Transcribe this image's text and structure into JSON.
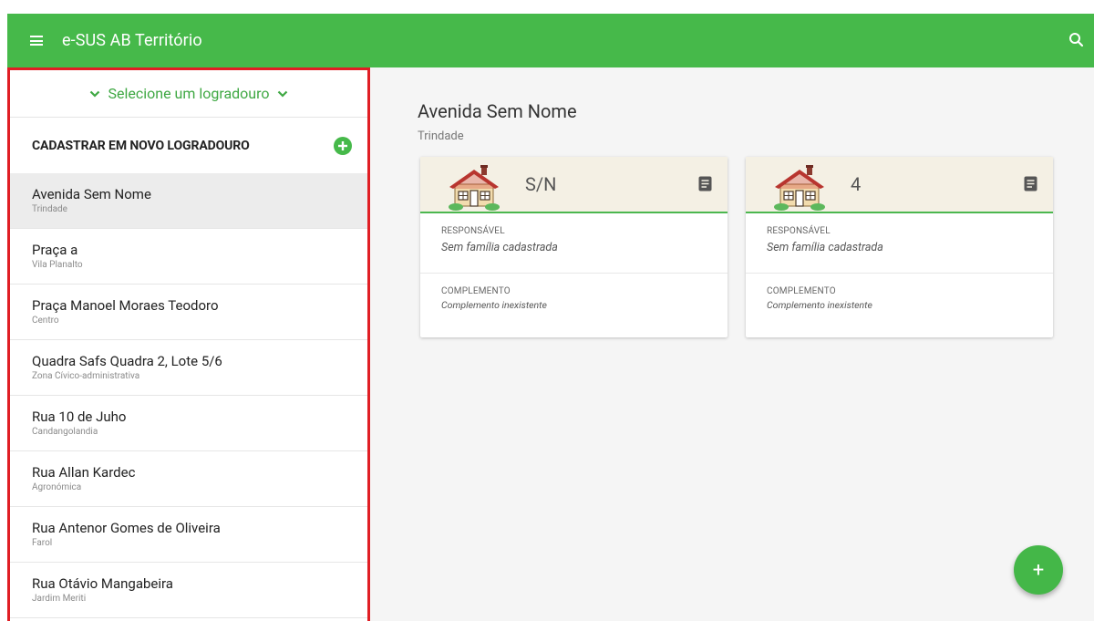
{
  "app": {
    "title": "e-SUS AB Território"
  },
  "icons": {
    "menu": "menu-icon",
    "search": "search-icon",
    "add": "add-circle-icon",
    "note": "note-icon",
    "house": "house-icon",
    "fab": "plus-icon"
  },
  "colors": {
    "primary": "#46b94a",
    "highlight_border": "#e01e24",
    "selected_row": "#ececec",
    "card_header": "#f4f0e4"
  },
  "sidebar": {
    "selector_label": "Selecione um logradouro",
    "new_label": "CADASTRAR EM NOVO LOGRADOURO",
    "items": [
      {
        "name": "Avenida Sem Nome",
        "district": "Trindade",
        "selected": true
      },
      {
        "name": "Praça a",
        "district": "Vila Planalto"
      },
      {
        "name": "Praça Manoel Moraes Teodoro",
        "district": "Centro"
      },
      {
        "name": "Quadra Safs Quadra 2, Lote 5/6",
        "district": "Zona Cívico-administrativa"
      },
      {
        "name": "Rua 10 de Juho",
        "district": "Candangolandia"
      },
      {
        "name": "Rua Allan Kardec",
        "district": "Agronómica"
      },
      {
        "name": "Rua Antenor Gomes de Oliveira",
        "district": "Farol"
      },
      {
        "name": "Rua Otávio Mangabeira",
        "district": "Jardim Meriti"
      }
    ]
  },
  "main": {
    "street": "Avenida Sem Nome",
    "district": "Trindade",
    "cards": [
      {
        "number": "S/N",
        "responsible_label": "RESPONSÁVEL",
        "responsible_value": "Sem família cadastrada",
        "complement_label": "COMPLEMENTO",
        "complement_value": "Complemento inexistente"
      },
      {
        "number": "4",
        "responsible_label": "RESPONSÁVEL",
        "responsible_value": "Sem família cadastrada",
        "complement_label": "COMPLEMENTO",
        "complement_value": "Complemento inexistente"
      }
    ],
    "fab_label": "+"
  }
}
